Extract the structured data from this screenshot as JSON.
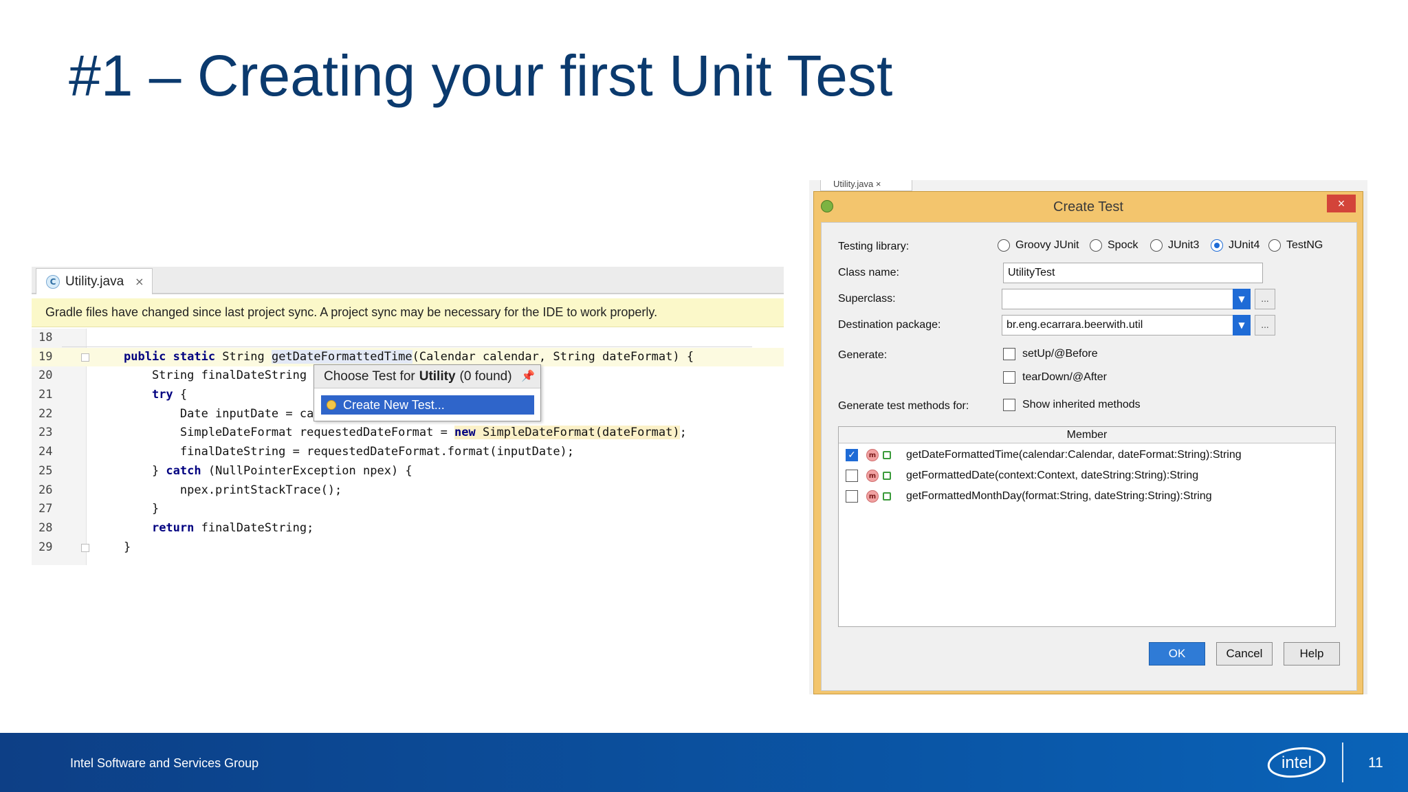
{
  "slide": {
    "title": "#1 – Creating your first Unit Test",
    "footer_text": "Intel Software and Services Group",
    "page_number": "11",
    "logo_text": "intel"
  },
  "ide": {
    "tab_icon_letter": "C",
    "tab_label": "Utility.java",
    "tab_close": "×",
    "notice": "Gradle files have changed since last project sync. A project sync may be necessary for the IDE to work properly.",
    "lines": [
      {
        "num": "18",
        "segments": [
          {
            "t": "",
            "c": ""
          }
        ]
      },
      {
        "num": "19",
        "segments": [
          {
            "t": "public static ",
            "c": "kw"
          },
          {
            "t": "String ",
            "c": ""
          },
          {
            "t": "getDateFormattedTime",
            "c": "hl-name"
          },
          {
            "t": "(Calendar calendar, String dateFormat) {",
            "c": ""
          }
        ]
      },
      {
        "num": "20",
        "segments": [
          {
            "t": "    String finalDateString = ",
            "c": ""
          }
        ]
      },
      {
        "num": "21",
        "segments": [
          {
            "t": "    ",
            "c": ""
          },
          {
            "t": "try",
            "c": "kw"
          },
          {
            "t": " {",
            "c": ""
          }
        ]
      },
      {
        "num": "22",
        "segments": [
          {
            "t": "        Date inputDate = cal",
            "c": ""
          }
        ]
      },
      {
        "num": "23",
        "segments": [
          {
            "t": "        SimpleDateFormat requestedDateFormat = ",
            "c": ""
          },
          {
            "t": "new",
            "c": "kw hl-new"
          },
          {
            "t": " SimpleDateFormat(dateFormat)",
            "c": "hl-new"
          },
          {
            "t": ";",
            "c": ""
          }
        ]
      },
      {
        "num": "24",
        "segments": [
          {
            "t": "        finalDateString = requestedDateFormat.format(inputDate);",
            "c": ""
          }
        ]
      },
      {
        "num": "25",
        "segments": [
          {
            "t": "    } ",
            "c": ""
          },
          {
            "t": "catch",
            "c": "kw"
          },
          {
            "t": " (NullPointerException npex) {",
            "c": ""
          }
        ]
      },
      {
        "num": "26",
        "segments": [
          {
            "t": "        npex.printStackTrace();",
            "c": ""
          }
        ]
      },
      {
        "num": "27",
        "segments": [
          {
            "t": "    }",
            "c": ""
          }
        ]
      },
      {
        "num": "28",
        "segments": [
          {
            "t": "    ",
            "c": ""
          },
          {
            "t": "return",
            "c": "kw"
          },
          {
            "t": " finalDateString;",
            "c": ""
          }
        ]
      },
      {
        "num": "29",
        "segments": [
          {
            "t": "}",
            "c": ""
          }
        ]
      }
    ],
    "popup": {
      "header_prefix": "Choose Test for",
      "header_class": "Utility",
      "header_suffix": "(0 found)",
      "item": "Create New Test..."
    }
  },
  "dialog": {
    "bg_tab": "Utility.java ×",
    "title": "Create Test",
    "close": "×",
    "testing_library_label": "Testing library:",
    "libraries": [
      {
        "label": "Groovy JUnit",
        "selected": false
      },
      {
        "label": "Spock",
        "selected": false
      },
      {
        "label": "JUnit3",
        "selected": false
      },
      {
        "label": "JUnit4",
        "selected": true
      },
      {
        "label": "TestNG",
        "selected": false
      }
    ],
    "class_name_label": "Class name:",
    "class_name_value": "UtilityTest",
    "superclass_label": "Superclass:",
    "superclass_value": "",
    "destination_label": "Destination package:",
    "destination_value": "br.eng.ecarrara.beerwith.util",
    "generate_label": "Generate:",
    "setup_label": "setUp/@Before",
    "teardown_label": "tearDown/@After",
    "methods_for_label": "Generate test methods for:",
    "inherited_label": "Show inherited methods",
    "member_header": "Member",
    "members": [
      {
        "checked": true,
        "signature": "getDateFormattedTime(calendar:Calendar, dateFormat:String):String"
      },
      {
        "checked": false,
        "signature": "getFormattedDate(context:Context, dateString:String):String"
      },
      {
        "checked": false,
        "signature": "getFormattedMonthDay(format:String, dateString:String):String"
      }
    ],
    "ok": "OK",
    "cancel": "Cancel",
    "help": "Help",
    "browse": "...",
    "combo_arrow": "▼"
  },
  "colors": {
    "title": "#0b3a6e",
    "dialog_frame": "#f3c56d",
    "accent_blue": "#1e6bd6",
    "footer_blue": "#0a57a8"
  }
}
